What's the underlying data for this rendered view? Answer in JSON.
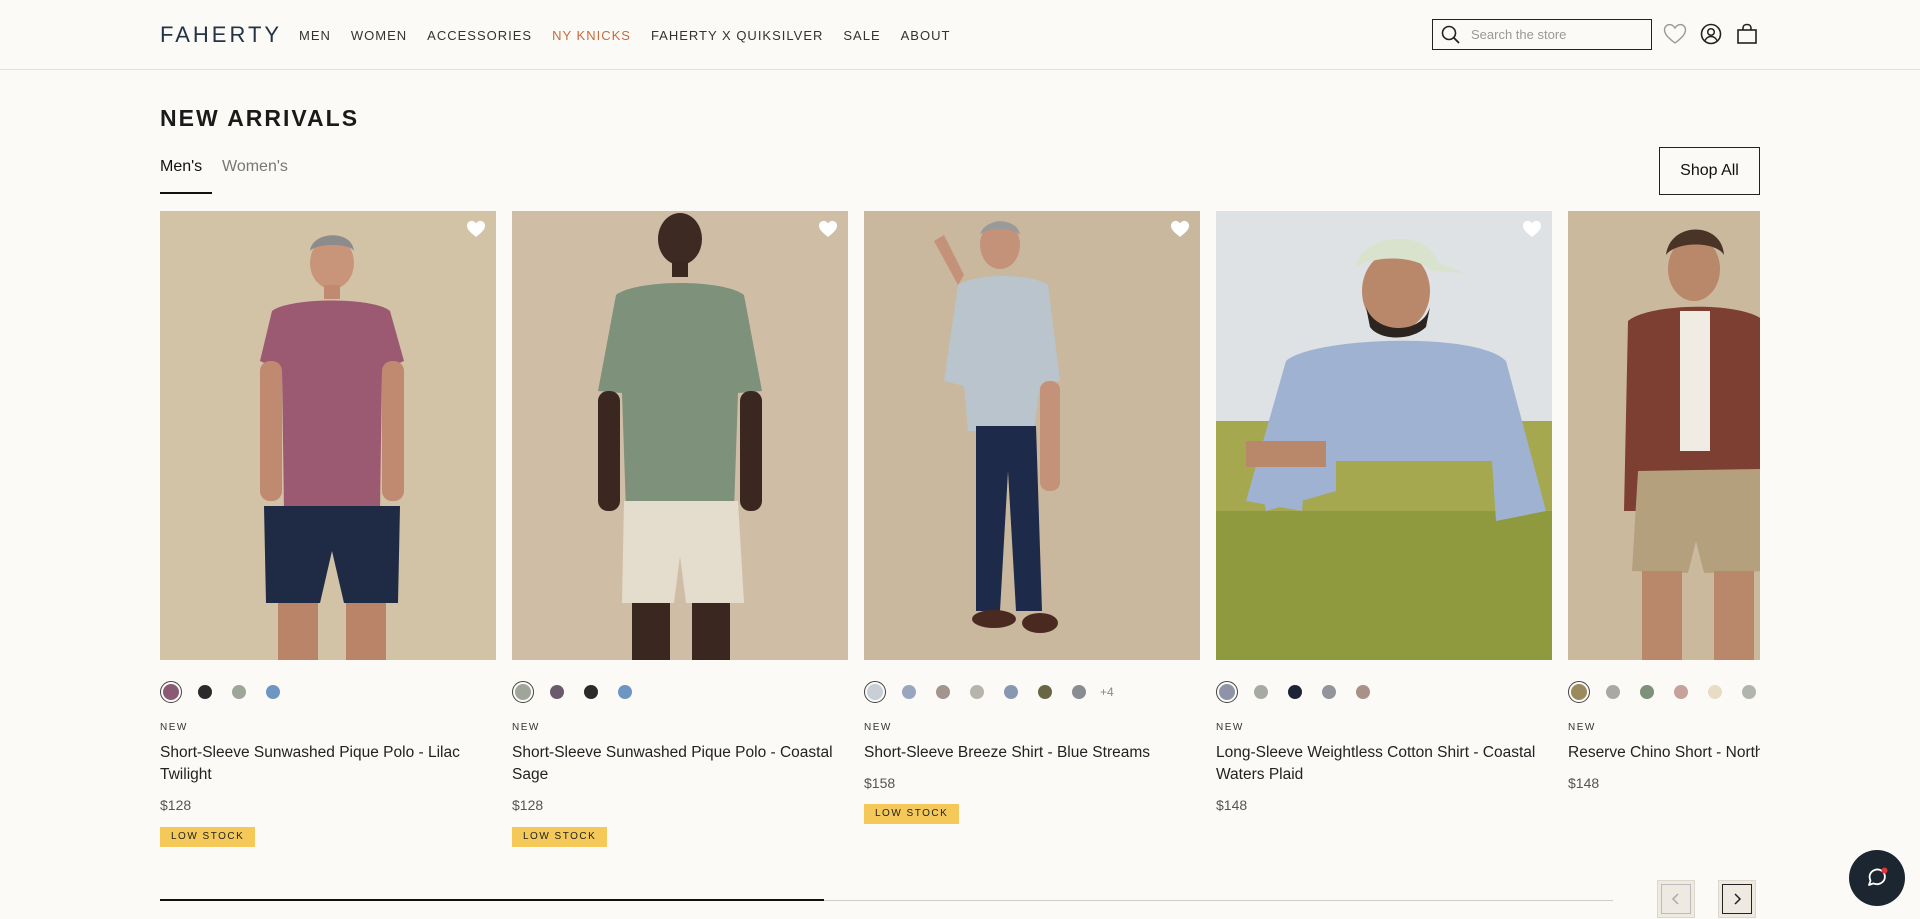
{
  "header": {
    "logo": "FAHERTY",
    "nav": [
      "MEN",
      "WOMEN",
      "ACCESSORIES",
      "NY KNICKS",
      "FAHERTY X QUIKSILVER",
      "SALE",
      "ABOUT"
    ],
    "nav_accent_item": "NY KNICKS",
    "accent_color": "#c46c3c",
    "search_placeholder": "Search the store",
    "icons": [
      "search-icon",
      "heart-icon",
      "account-icon",
      "bag-icon"
    ]
  },
  "section": {
    "title": "NEW ARRIVALS",
    "tabs": [
      "Men's",
      "Women's"
    ],
    "active_tab": "Men's",
    "shop_all": "Shop All"
  },
  "products": [
    {
      "tag": "NEW",
      "name": "Short-Sleeve Sunwashed Pique Polo - Lilac Twilight",
      "price": "$128",
      "badge": "LOW STOCK",
      "swatches": [
        "#8a5a72",
        "#2b2b2b",
        "#9ea69a",
        "#6f95c2"
      ],
      "shirt_color": "#9b5a72",
      "bottom_color": "#1f2a44"
    },
    {
      "tag": "NEW",
      "name": "Short-Sleeve Sunwashed Pique Polo - Coastal Sage",
      "price": "$128",
      "badge": "LOW STOCK",
      "swatches": [
        "#9ea69a",
        "#6b5a6a",
        "#2b2b2b",
        "#6f95c2"
      ],
      "shirt_color": "#7e917a",
      "bottom_color": "#e4dccc"
    },
    {
      "tag": "NEW",
      "name": "Short-Sleeve Breeze Shirt - Blue Streams",
      "price": "$158",
      "badge": "LOW STOCK",
      "swatches": [
        "#c9cfd6",
        "#98a6c0",
        "#a4948e",
        "#b7b4ac",
        "#8898b0",
        "#6a6544",
        "#8a8c94"
      ],
      "more": "+4",
      "shirt_color": "#b9c4cc",
      "bottom_color": "#1e2a4a"
    },
    {
      "tag": "NEW",
      "name": "Long-Sleeve Weightless Cotton Shirt - Coastal Waters Plaid",
      "price": "$148",
      "badge": "",
      "swatches": [
        "#8e93a8",
        "#a7aaa2",
        "#1e2438",
        "#92959c",
        "#a99088"
      ],
      "shirt_color": "#9fb2d2",
      "bottom_color": "#9ba85a"
    },
    {
      "tag": "NEW",
      "name": "Reserve Chino Short - North",
      "price": "$148",
      "badge": "",
      "swatches": [
        "#9a8a5e",
        "#a8a9a6",
        "#7d9279",
        "#c5a29a",
        "#e9dcc6",
        "#b2b4ae"
      ],
      "shirt_color": "#7c3f32",
      "bottom_color": "#b5a07e"
    }
  ],
  "carousel": {
    "progress": 0.457
  },
  "chat": {
    "icon": "chat-icon"
  }
}
